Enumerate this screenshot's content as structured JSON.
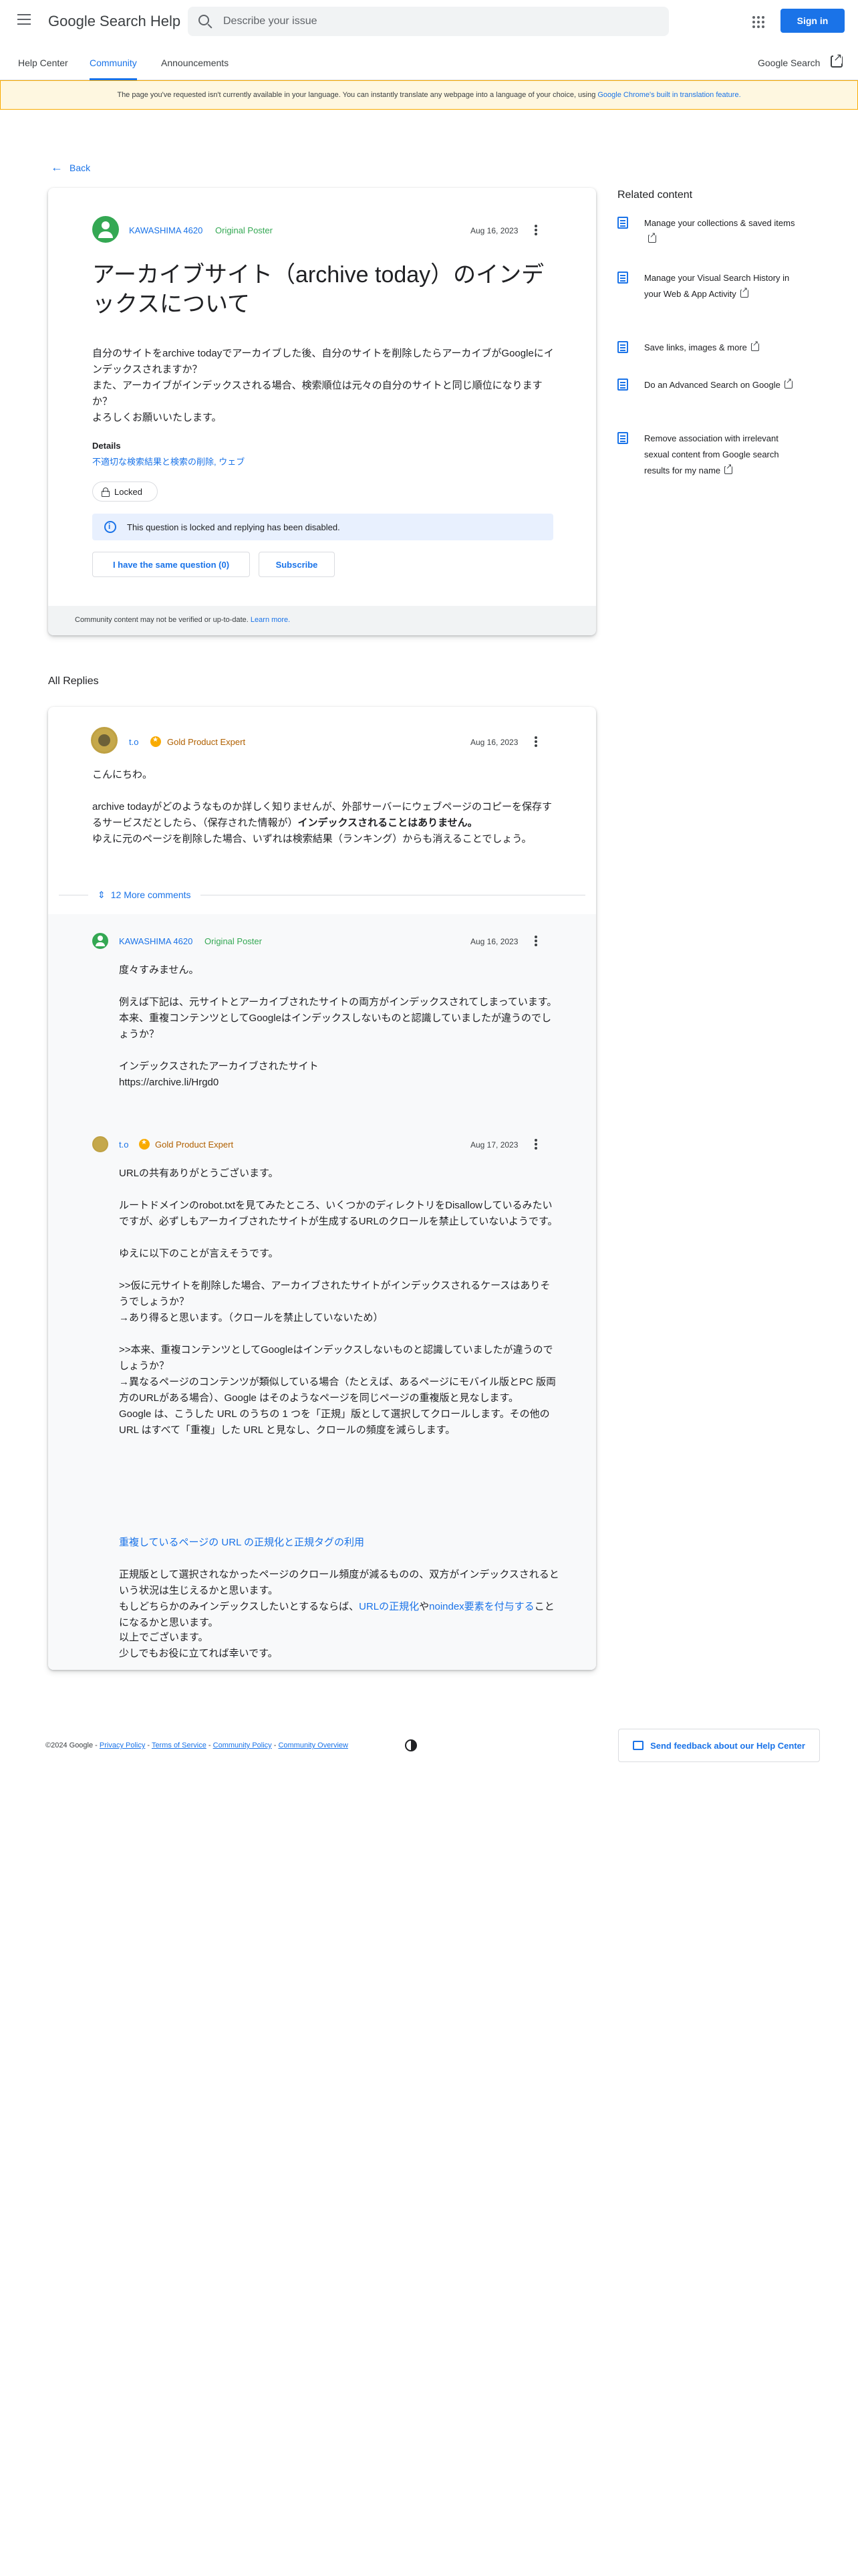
{
  "header": {
    "brand": "Google Search Help",
    "search_placeholder": "Describe your issue",
    "sign_in": "Sign in"
  },
  "nav": {
    "tabs": [
      "Help Center",
      "Community",
      "Announcements"
    ],
    "active_tab": "Community",
    "right_link": "Google Search"
  },
  "banner": {
    "text": "The page you've requested isn't currently available in your language. You can instantly translate any webpage into a language of your choice, using ",
    "link": "Google Chrome's built in translation feature."
  },
  "back_label": "Back",
  "question": {
    "author": "KAWASHIMA 4620",
    "author_badge": "Original Poster",
    "date": "Aug 16, 2023",
    "title": "アーカイブサイト（archive today）のインデックスについて",
    "body": "自分のサイトをarchive todayでアーカイブした後、自分のサイトを削除したらアーカイブがGoogleにインデックスされますか？\nまた、アーカイブがインデックスされる場合、検索順位は元々の自分のサイトと同じ順位になりますか？\nよろしくお願いいたします。",
    "details_label": "Details",
    "details_link": "不適切な検索結果と検索の削除, ウェブ",
    "locked_label": "Locked",
    "info_text": "This question is locked and replying has been disabled.",
    "same_question_btn": "I have the same question (0)",
    "subscribe_btn": "Subscribe",
    "footer_text": "Community content may not be verified or up-to-date.",
    "footer_link": "Learn more."
  },
  "all_replies_label": "All Replies",
  "reply": {
    "author": "t.o",
    "badge": "Gold Product Expert",
    "date": "Aug 16, 2023",
    "body_1": "こんにちわ。",
    "body_2a": "archive todayがどのようなものか詳しく知りませんが、外部サーバーにウェブページのコピーを保存するサービスだとしたら、（保存された情報が）",
    "body_2b": "インデックスされることはありません。",
    "body_2c": "ゆえに元のページを削除した場合、いずれは検索結果（ランキング）からも消えることでしょう。",
    "more_comments": "12 More comments"
  },
  "comment1": {
    "author": "KAWASHIMA 4620",
    "badge": "Original Poster",
    "date": "Aug 16, 2023",
    "body": "度々すみません。\n\n例えば下記は、元サイトとアーカイブされたサイトの両方がインデックスされてしまっています。\n本来、重複コンテンツとしてGoogleはインデックスしないものと認識していましたが違うのでしょうか？\n\nインデックスされたアーカイブされたサイト\nhttps://archive.li/Hrgd0"
  },
  "comment2": {
    "author": "t.o",
    "badge": "Gold Product Expert",
    "date": "Aug 17, 2023",
    "body_1": "URLの共有ありがとうございます。\n\nルートドメインのrobot.txtを見てみたところ、いくつかのディレクトリをDisallowしているみたいですが、必ずしもアーカイブされたサイトが生成するURLのクロールを禁止していないようです。\n\nゆえに以下のことが言えそうです。\n\n>>仮に元サイトを削除した場合、アーカイブされたサイトがインデックスされるケースはありそうでしょうか？\n→あり得ると思います。（クロールを禁止していないため）\n\n>>本来、重複コンテンツとしてGoogleはインデックスしないものと認識していましたが違うのでしょうか？\n→異なるページのコンテンツが類似している場合（たとえば、あるページにモバイル版とPC 版両方のURLがある場合）、Google はそのようなページを同じページの重複版と見なします。\nGoogle は、こうした URL のうちの 1 つを「正規」版として選択してクロールします。その他の URL はすべて「重複」した URL と見なし、クロールの頻度を減らします。",
    "link_1": "重複しているページの URL の正規化と正規タグの利用",
    "body_2": "正規版として選択されなかったページのクロール頻度が減るものの、双方がインデックスされるという状況は生じえるかと思います。\nもしどちらかのみインデックスしたいとするならば、",
    "link_2": "URLの正規化",
    "body_2_mid": "や",
    "link_3": "noindex要素を付与する",
    "body_2_end": "ことになるかと思います。",
    "body_3": "以上でございます。\n少しでもお役に立てれば幸いです。"
  },
  "related": {
    "title": "Related content",
    "items": [
      "Manage your collections & saved items",
      "Manage your Visual Search History in your Web & App Activity",
      "Save links, images & more",
      "Do an Advanced Search on Google",
      "Remove association with irrelevant sexual content from Google search results for my name"
    ]
  },
  "footer": {
    "copyright": "©2024 Google -",
    "links": [
      "Privacy Policy",
      "Terms of Service",
      "Community Policy",
      "Community Overview"
    ],
    "feedback": "Send feedback about our Help Center"
  },
  "colors": {
    "accent": "#1a73e8",
    "original_poster": "#34a853",
    "gold_badge": "#f9ab00",
    "banner_bg": "#fef7e0"
  }
}
